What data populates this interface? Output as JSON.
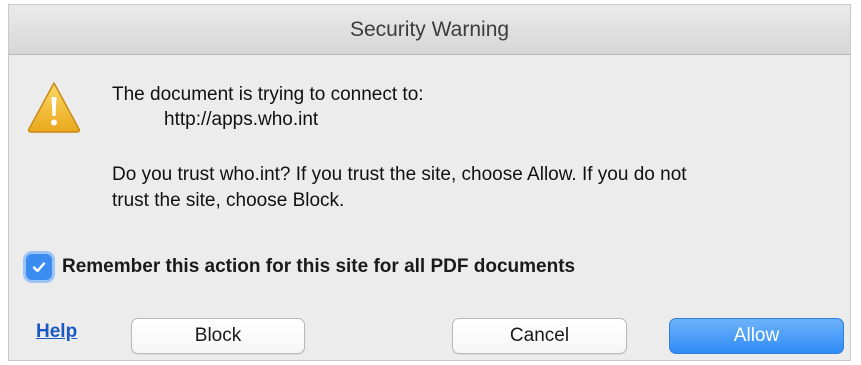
{
  "window": {
    "title": "Security Warning"
  },
  "icons": {
    "warning": "warning-triangle-icon",
    "check": "checkmark-icon"
  },
  "message": {
    "line1": "The document is trying to connect to:",
    "url": "http://apps.who.int",
    "question_line1": "Do you trust who.int? If you trust the site, choose Allow. If you do not",
    "question_line2": "trust the site, choose Block."
  },
  "remember": {
    "label": "Remember this action for this site for all PDF documents",
    "checked": true
  },
  "buttons": {
    "help": "Help",
    "block": "Block",
    "cancel": "Cancel",
    "allow": "Allow"
  },
  "colors": {
    "accent": "#3b8cf0",
    "warning_fill": "#f5c23c",
    "link": "#1a58c4",
    "window_bg": "#ececec"
  }
}
